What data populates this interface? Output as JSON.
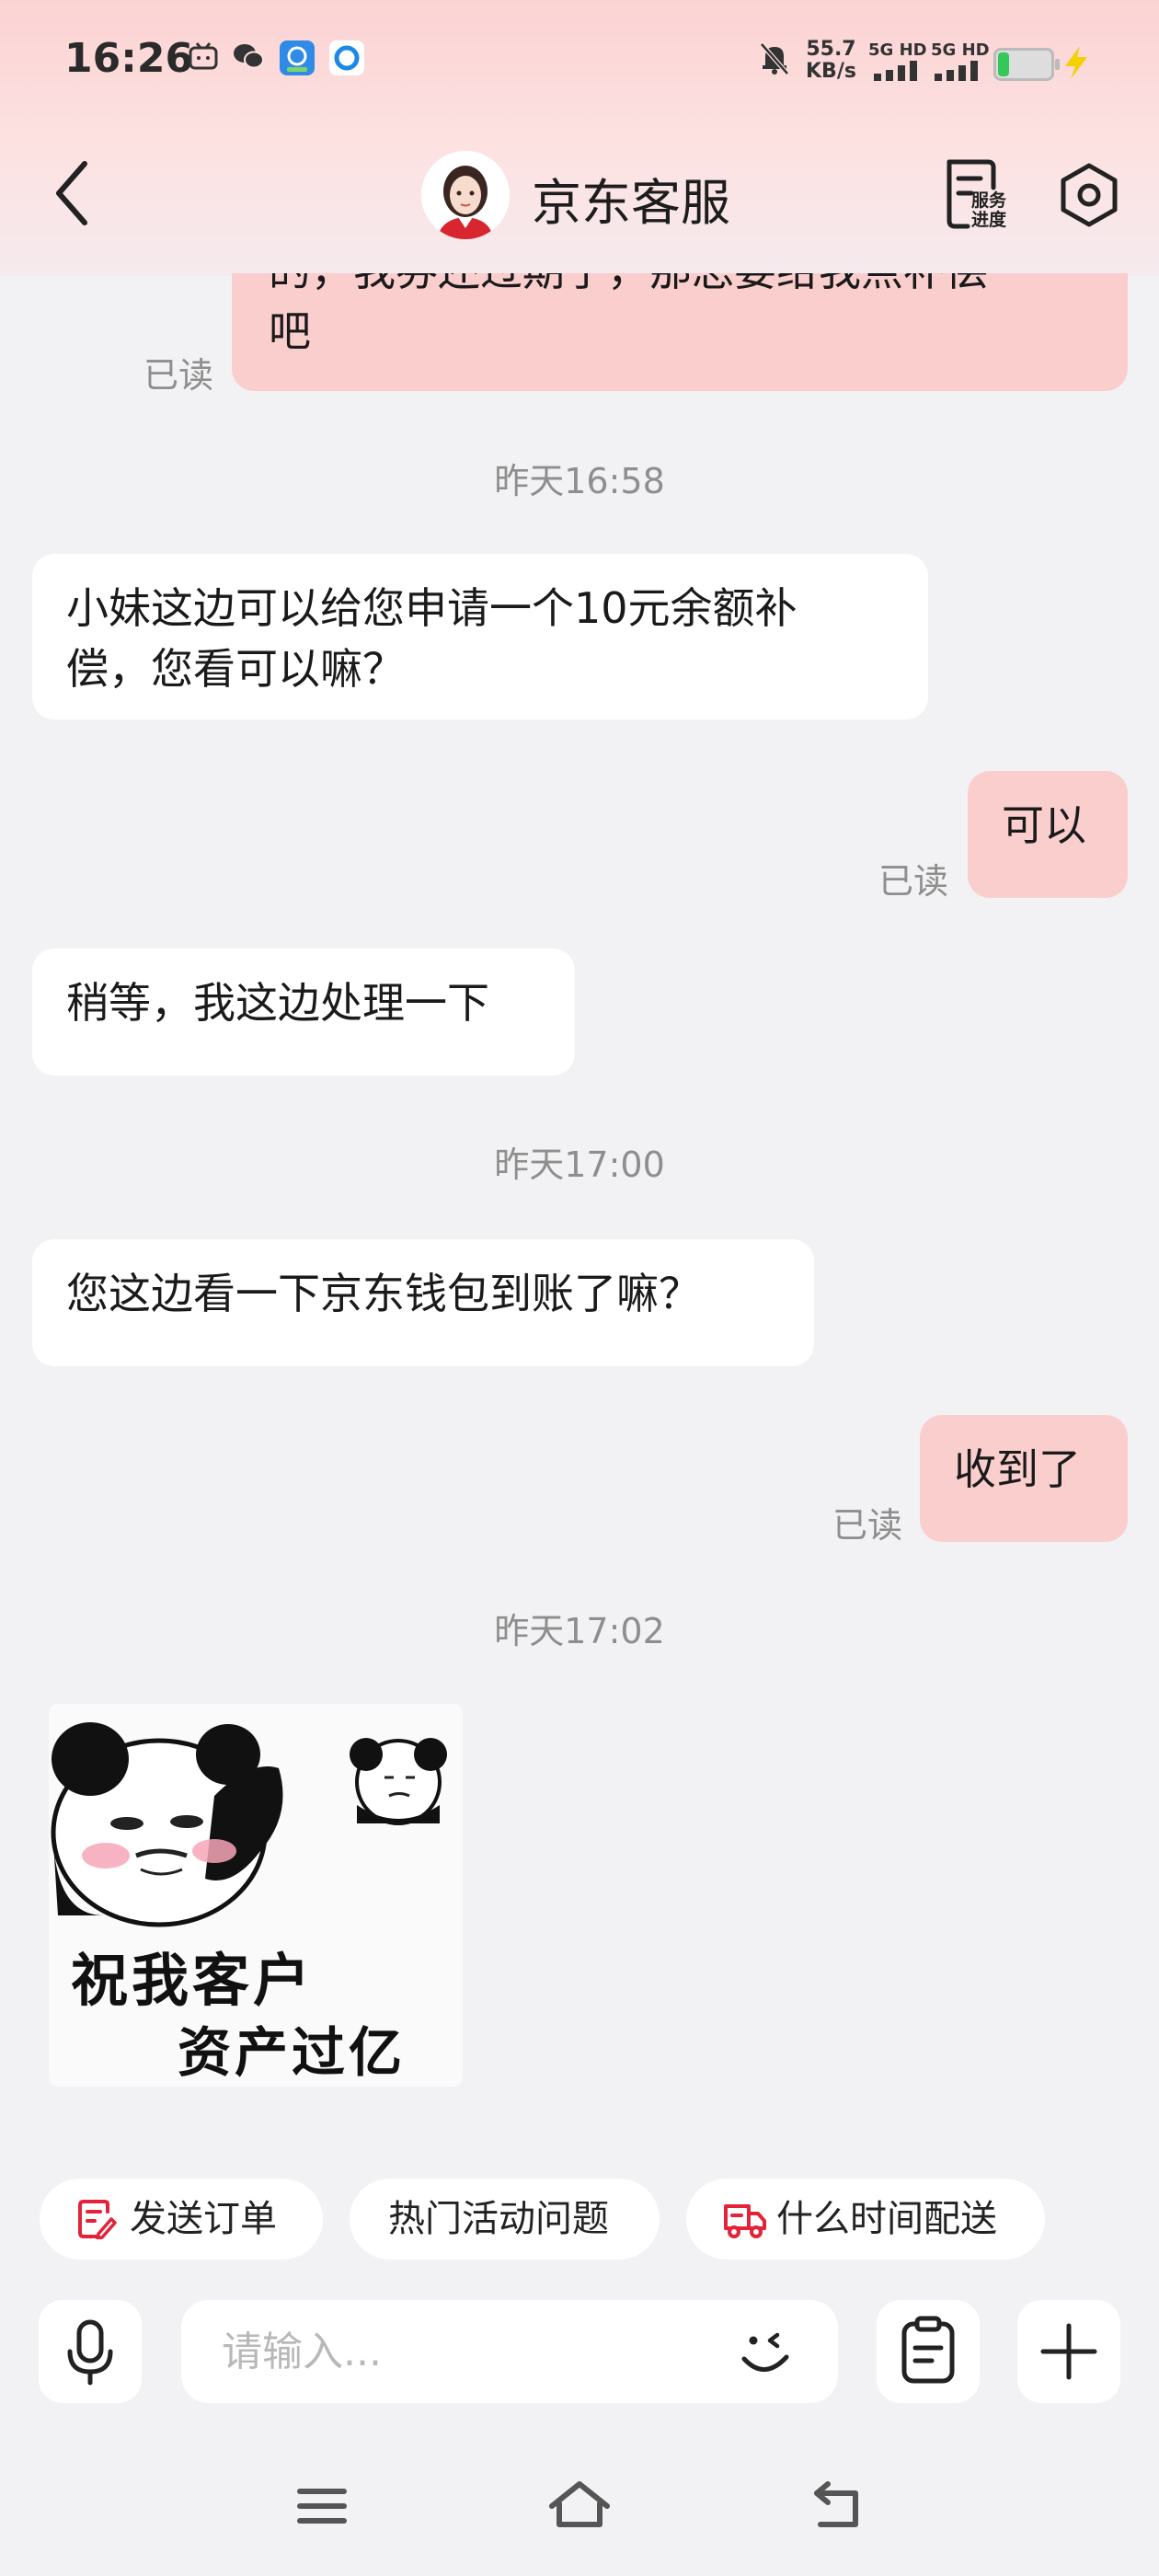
{
  "status_bar": {
    "time": "16:26",
    "net_speed_value": "55.7",
    "net_speed_unit": "KB/s",
    "signal_1": "5G HD",
    "signal_2": "5G HD",
    "icons": [
      "bilibili-icon",
      "wechat-icon",
      "app-icon",
      "browser-icon",
      "mute-bell-icon",
      "battery-icon",
      "charging-icon"
    ]
  },
  "header": {
    "title": "京东客服",
    "service_progress_label_line1": "服务",
    "service_progress_label_line2": "进度"
  },
  "messages": [
    {
      "sender": "me",
      "text": "的，我券还过期了，那总要给我点补偿吧",
      "line1": "的，我券还过期了，那总要给我点补偿",
      "line2": "吧",
      "status": "已读"
    },
    {
      "type": "timestamp",
      "text": "昨天16:58"
    },
    {
      "sender": "agent",
      "line1": "小妹这边可以给您申请一个10元余额补",
      "line2": "偿，您看可以嘛？"
    },
    {
      "sender": "me",
      "text": "可以",
      "status": "已读"
    },
    {
      "sender": "agent",
      "text": "稍等，我这边处理一下"
    },
    {
      "type": "timestamp",
      "text": "昨天17:00"
    },
    {
      "sender": "agent",
      "text": "您这边看一下京东钱包到账了嘛？"
    },
    {
      "sender": "me",
      "text": "收到了",
      "status": "已读"
    },
    {
      "type": "timestamp",
      "text": "昨天17:02"
    },
    {
      "sender": "agent",
      "type": "sticker",
      "sticker_line1": "祝我客户",
      "sticker_line2": "资产过亿"
    }
  ],
  "quick_actions": [
    {
      "label": "发送订单",
      "icon": "send-order-icon"
    },
    {
      "label": "热门活动问题",
      "icon": ""
    },
    {
      "label": "什么时间配送",
      "icon": "delivery-truck-icon"
    }
  ],
  "input": {
    "placeholder": "请输入...",
    "value": ""
  },
  "colors": {
    "accent": "#e2233a",
    "my_bubble": "#fbcece",
    "agent_bubble": "#ffffff",
    "background": "#f2f2f4"
  }
}
